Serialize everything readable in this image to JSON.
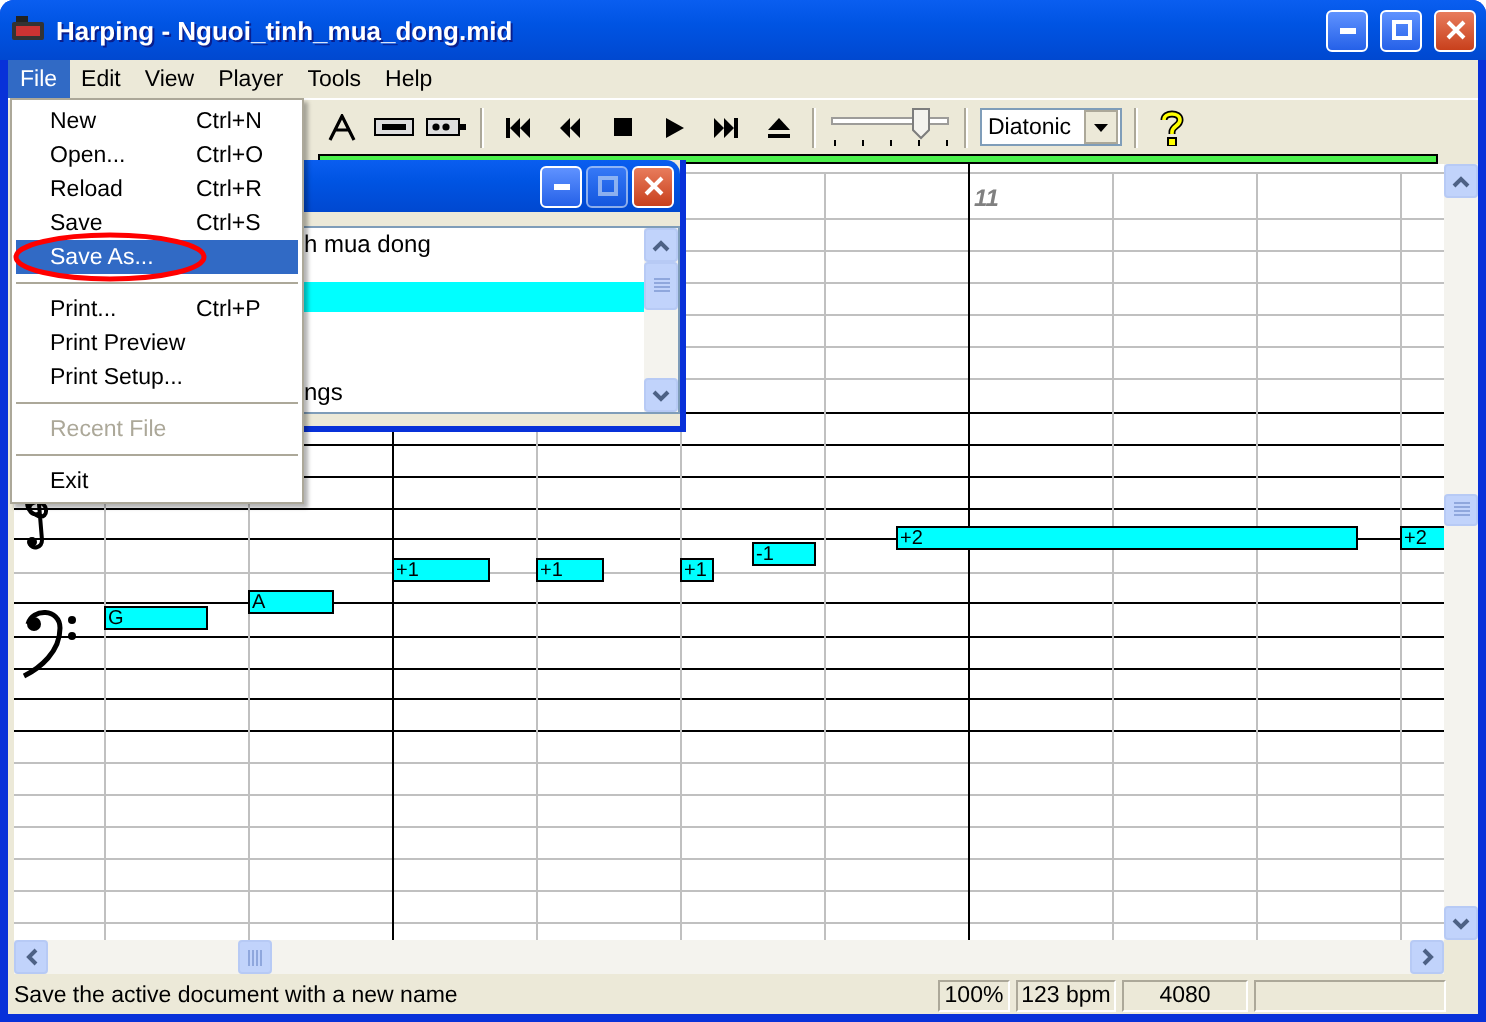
{
  "window": {
    "title": "Harping - Nguoi_tinh_mua_dong.mid"
  },
  "menu_bar": [
    {
      "label": "File",
      "selected": true
    },
    {
      "label": "Edit",
      "selected": false
    },
    {
      "label": "View",
      "selected": false
    },
    {
      "label": "Player",
      "selected": false
    },
    {
      "label": "Tools",
      "selected": false
    },
    {
      "label": "Help",
      "selected": false
    }
  ],
  "file_menu": [
    {
      "kind": "item",
      "label": "New",
      "shortcut": "Ctrl+N",
      "selected": false,
      "disabled": false,
      "circled": false
    },
    {
      "kind": "item",
      "label": "Open...",
      "shortcut": "Ctrl+O",
      "selected": false,
      "disabled": false,
      "circled": false
    },
    {
      "kind": "item",
      "label": "Reload",
      "shortcut": "Ctrl+R",
      "selected": false,
      "disabled": false,
      "circled": false
    },
    {
      "kind": "item",
      "label": "Save",
      "shortcut": "Ctrl+S",
      "selected": false,
      "disabled": false,
      "circled": false
    },
    {
      "kind": "item",
      "label": "Save As...",
      "selected": true,
      "disabled": false,
      "circled": true
    },
    {
      "kind": "separator"
    },
    {
      "kind": "item",
      "label": "Print...",
      "shortcut": "Ctrl+P",
      "selected": false,
      "disabled": false,
      "circled": false
    },
    {
      "kind": "item",
      "label": "Print Preview",
      "selected": false,
      "disabled": false,
      "circled": false
    },
    {
      "kind": "item",
      "label": "Print Setup...",
      "selected": false,
      "disabled": false,
      "circled": false
    },
    {
      "kind": "separator"
    },
    {
      "kind": "item",
      "label": "Recent File",
      "selected": false,
      "disabled": true,
      "circled": false
    },
    {
      "kind": "separator"
    },
    {
      "kind": "item",
      "label": "Exit",
      "selected": false,
      "disabled": false,
      "circled": false
    }
  ],
  "toolbar": {
    "tempo_slider": {
      "level": 0.75
    },
    "mode_select": {
      "value": "Diatonic"
    }
  },
  "track_window": {
    "rows": [
      {
        "text": "h mua dong",
        "selected": false
      },
      {
        "selected": true
      },
      {
        "text": "ngs",
        "selected": false
      }
    ]
  },
  "score": {
    "measure_label": "11",
    "notes": [
      {
        "label": "G"
      },
      {
        "label": "A"
      },
      {
        "label": "+1"
      },
      {
        "label": "+1"
      },
      {
        "label": "+1"
      },
      {
        "label": "-1"
      },
      {
        "label": "+2"
      },
      {
        "label": "+2"
      }
    ]
  },
  "status_bar": {
    "message": "Save the active document with a new name",
    "panes": [
      "100%",
      "123 bpm",
      "4080"
    ]
  }
}
